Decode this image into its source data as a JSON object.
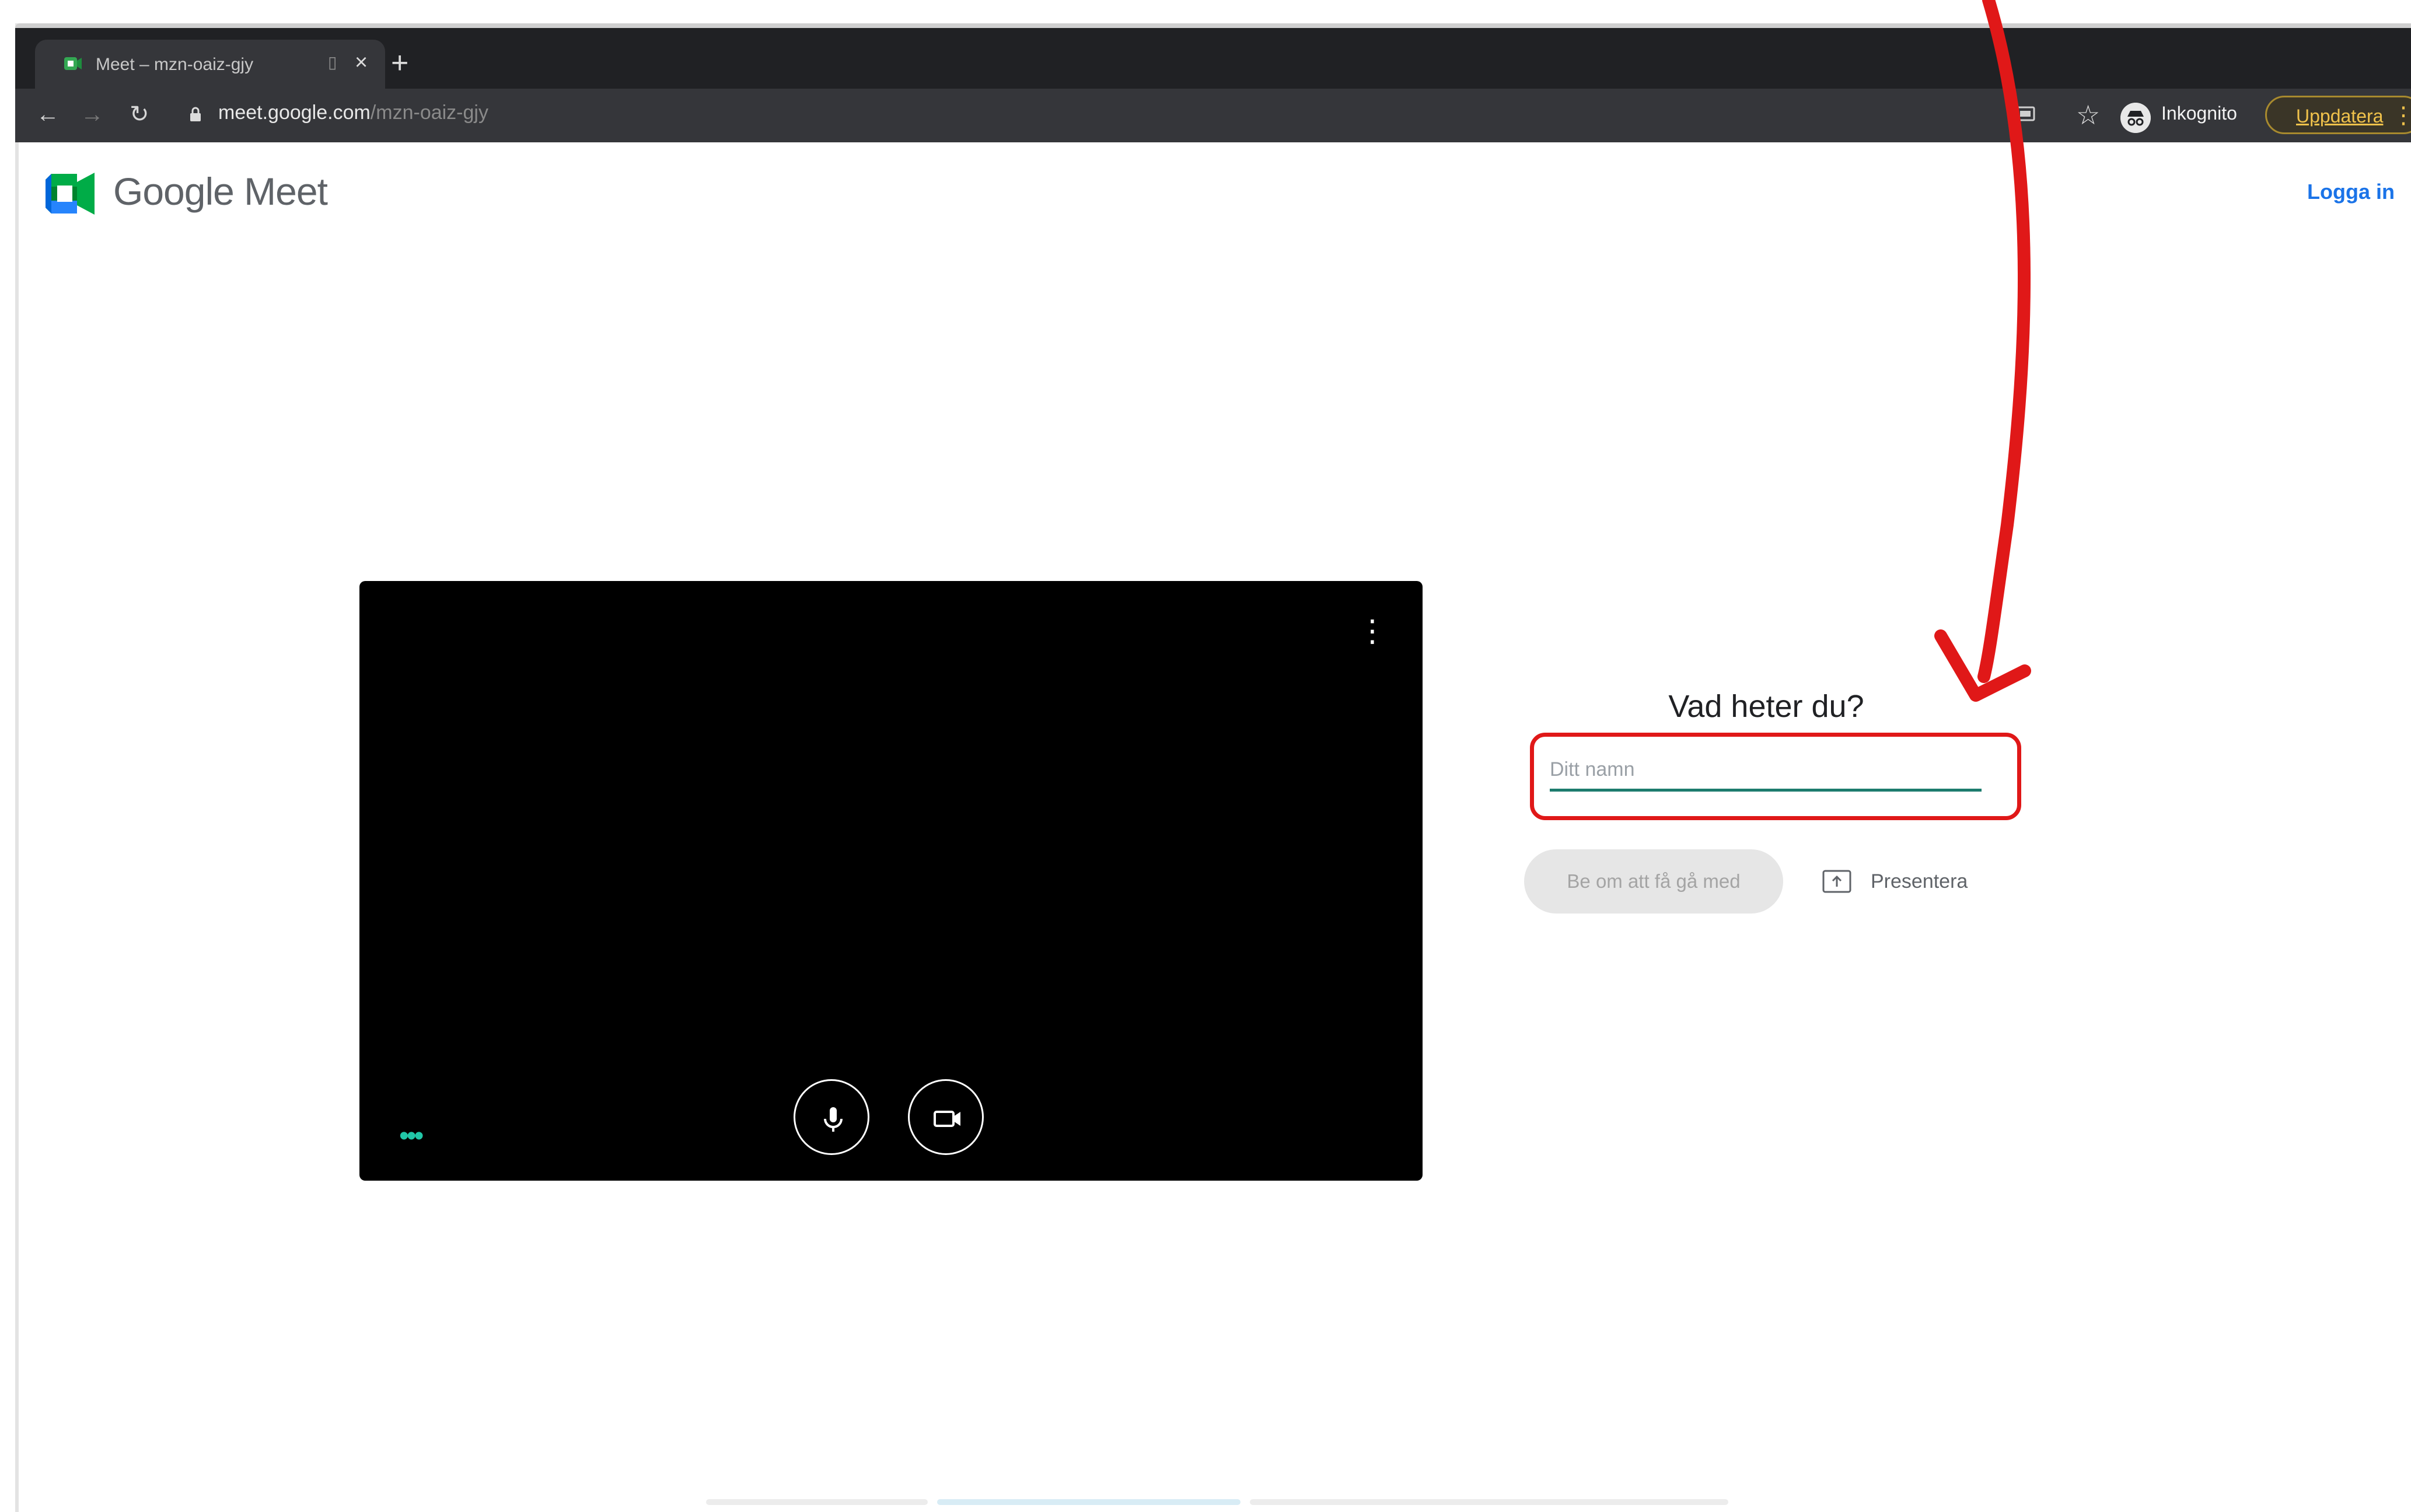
{
  "browser": {
    "tab_title": "Meet – mzn-oaiz-gjy",
    "tab_close": "×",
    "new_tab": "+",
    "url_host": "meet.google.com",
    "url_path": "/mzn-oaiz-gjy",
    "incognito_label": "Inkognito",
    "update_label": "Uppdatera",
    "icons": [
      "back-icon",
      "forward-icon",
      "reload-icon",
      "lock-icon",
      "cast-icon",
      "star-icon",
      "incognito-icon",
      "menu-icon"
    ]
  },
  "header": {
    "brand_google": "Google",
    "brand_meet": "Meet",
    "login_label": "Logga in"
  },
  "join": {
    "title": "Vad heter du?",
    "name_placeholder": "Ditt namn",
    "name_value": "",
    "ask_button": "Be om att få gå med",
    "present_label": "Presentera"
  },
  "colors": {
    "accent": "#1a73e8",
    "input_underline": "#1d7c6e",
    "annotation": "#e01818",
    "chrome_bg": "#202124"
  }
}
